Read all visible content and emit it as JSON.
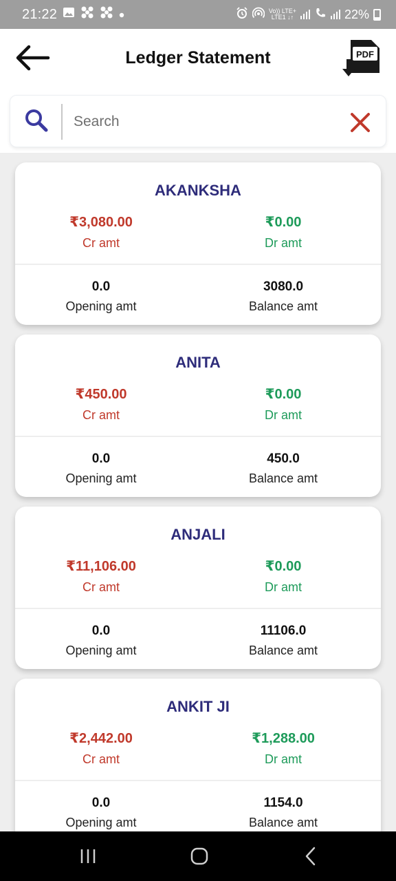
{
  "status_bar": {
    "time": "21:22",
    "network_label_top": "Vo)) LTE+",
    "network_label_bottom": "LTE1 ↓↑",
    "battery_percent": "22%",
    "battery_level": 0.22
  },
  "header": {
    "title": "Ledger Statement",
    "pdf_label": "PDF"
  },
  "search": {
    "placeholder": "Search",
    "value": ""
  },
  "colors": {
    "title_name": "#2e2c7a",
    "credit": "#c0392b",
    "debit": "#1e9b5a",
    "search_icon": "#3b3aa0",
    "clear_icon": "#c0392b"
  },
  "labels": {
    "cr": "Cr amt",
    "dr": "Dr amt",
    "opening": "Opening amt",
    "balance": "Balance amt"
  },
  "ledgers": [
    {
      "name": "AKANKSHA",
      "cr_amount": "₹3,080.00",
      "dr_amount": "₹0.00",
      "opening": "0.0",
      "balance": "3080.0"
    },
    {
      "name": "ANITA",
      "cr_amount": "₹450.00",
      "dr_amount": "₹0.00",
      "opening": "0.0",
      "balance": "450.0"
    },
    {
      "name": "ANJALI",
      "cr_amount": "₹11,106.00",
      "dr_amount": "₹0.00",
      "opening": "0.0",
      "balance": "11106.0"
    },
    {
      "name": "ANKIT JI",
      "cr_amount": "₹2,442.00",
      "dr_amount": "₹1,288.00",
      "opening": "0.0",
      "balance": "1154.0"
    }
  ]
}
